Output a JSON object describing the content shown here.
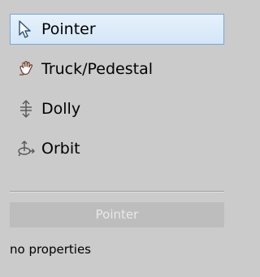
{
  "tools": [
    {
      "label": "Pointer",
      "icon": "pointer-arrow-icon",
      "selected": true
    },
    {
      "label": "Truck/Pedestal",
      "icon": "hand-pan-icon",
      "selected": false
    },
    {
      "label": "Dolly",
      "icon": "dolly-arrows-icon",
      "selected": false
    },
    {
      "label": "Orbit",
      "icon": "orbit-icon",
      "selected": false
    }
  ],
  "properties": {
    "header": "Pointer",
    "message": "no properties"
  },
  "colors": {
    "panel_bg": "#cbcbcb",
    "selected_bg": "#d9e8f8",
    "selected_border": "#7aa7d6",
    "header_bg": "#bdbdbd",
    "header_text": "#e9e9e9"
  }
}
